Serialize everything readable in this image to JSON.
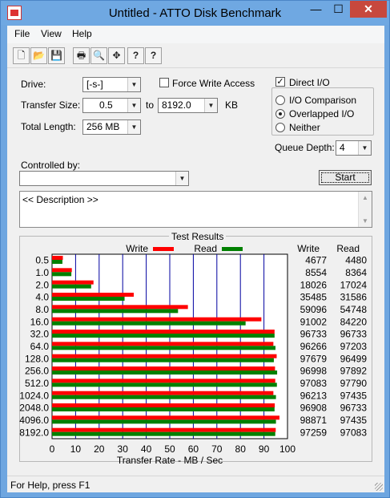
{
  "window": {
    "title": "Untitled - ATTO Disk Benchmark",
    "min_glyph": "—",
    "max_glyph": "☐",
    "close_glyph": "✕"
  },
  "menu": {
    "file": "File",
    "view": "View",
    "help": "Help"
  },
  "toolbar": {
    "icons": [
      "new-icon",
      "open-icon",
      "save-icon",
      "print-icon",
      "print-preview-icon",
      "move-icon",
      "help-icon",
      "context-help-icon"
    ],
    "glyphs": [
      "🗋",
      "📂",
      "💾",
      "🖶",
      "🔍",
      "✥",
      "?",
      "?"
    ]
  },
  "form": {
    "drive_label": "Drive:",
    "drive_value": "[-s-]",
    "force_write_label": "Force Write Access",
    "force_write_checked": false,
    "transfer_size_label": "Transfer Size:",
    "transfer_from": "0.5",
    "to_label": "to",
    "transfer_to": "8192.0",
    "unit_label": "KB",
    "total_length_label": "Total Length:",
    "total_length_value": "256 MB",
    "direct_io_label": "Direct I/O",
    "direct_io_checked": true,
    "io_comparison_label": "I/O Comparison",
    "overlapped_io_label": "Overlapped I/O",
    "neither_label": "Neither",
    "selected_io_mode": "Overlapped I/O",
    "queue_depth_label": "Queue Depth:",
    "queue_depth_value": "4",
    "controlled_by_label": "Controlled by:",
    "controlled_by_value": "",
    "start_label": "Start",
    "description_text": "<< Description >>"
  },
  "results": {
    "title": "Test Results",
    "write_col": "Write",
    "read_col": "Read"
  },
  "chart_data": {
    "type": "bar",
    "orientation": "horizontal",
    "title": "Test Results",
    "xlabel": "Transfer Rate - MB / Sec",
    "xlim": [
      0,
      100
    ],
    "xticks": [
      0,
      10,
      20,
      30,
      40,
      50,
      60,
      70,
      80,
      90,
      100
    ],
    "grid": "vertical",
    "categories": [
      "0.5",
      "1.0",
      "2.0",
      "4.0",
      "8.0",
      "16.0",
      "32.0",
      "64.0",
      "128.0",
      "256.0",
      "512.0",
      "1024.0",
      "2048.0",
      "4096.0",
      "8192.0"
    ],
    "series": [
      {
        "name": "Write",
        "color": "#ff0000",
        "values": [
          4.6,
          8.4,
          17.6,
          34.7,
          57.7,
          88.9,
          94.5,
          94.0,
          95.4,
          94.7,
          94.8,
          94.0,
          94.6,
          96.6,
          95.0
        ],
        "table": [
          "4677",
          "8554",
          "18026",
          "35485",
          "59096",
          "91002",
          "96733",
          "96266",
          "97679",
          "96998",
          "97083",
          "96213",
          "96908",
          "98871",
          "97259"
        ]
      },
      {
        "name": "Read",
        "color": "#008000",
        "values": [
          4.4,
          8.2,
          16.6,
          30.8,
          53.5,
          82.2,
          94.5,
          94.9,
          94.2,
          95.6,
          95.5,
          95.1,
          94.5,
          95.1,
          94.8
        ],
        "table": [
          "4480",
          "8364",
          "17024",
          "31586",
          "54748",
          "84220",
          "96733",
          "97203",
          "96499",
          "97892",
          "97790",
          "97435",
          "96733",
          "97435",
          "97083"
        ]
      }
    ]
  },
  "status": {
    "text": "For Help, press F1"
  }
}
